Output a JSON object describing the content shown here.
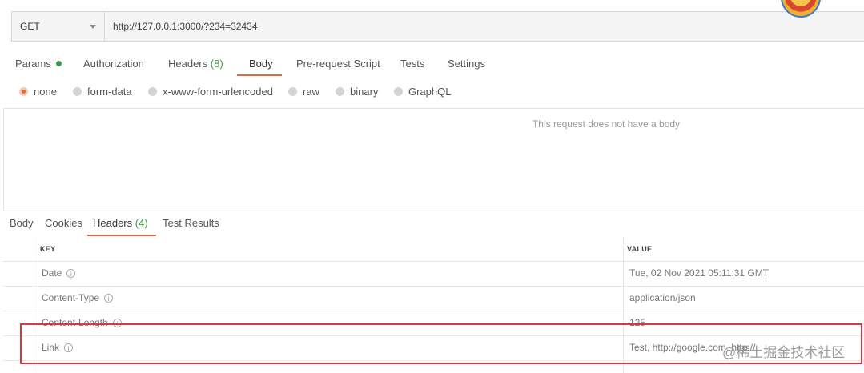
{
  "request": {
    "method": "GET",
    "url": "http://127.0.0.1:3000/?234=32434"
  },
  "req_tabs": [
    {
      "label": "Params"
    },
    {
      "label": "Authorization"
    },
    {
      "label": "Headers",
      "count": "(8)"
    },
    {
      "label": "Body"
    },
    {
      "label": "Pre-request Script"
    },
    {
      "label": "Tests"
    },
    {
      "label": "Settings"
    }
  ],
  "body_types": [
    "none",
    "form-data",
    "x-www-form-urlencoded",
    "raw",
    "binary",
    "GraphQL"
  ],
  "body_empty_text": "This request does not have a body",
  "resp_tabs": [
    {
      "label": "Body"
    },
    {
      "label": "Cookies"
    },
    {
      "label": "Headers",
      "count": "(4)"
    },
    {
      "label": "Test Results"
    }
  ],
  "headers_table": {
    "columns": [
      "KEY",
      "VALUE"
    ],
    "rows": [
      {
        "key": "Date",
        "value": "Tue, 02 Nov 2021 05:11:31 GMT"
      },
      {
        "key": "Content-Type",
        "value": "application/json"
      },
      {
        "key": "Content-Length",
        "value": "125"
      },
      {
        "key": "Link",
        "value": "Test, http://google.com, http://"
      }
    ]
  },
  "watermark": "@稀土掘金技术社区",
  "colors": {
    "accent": "#e3683e",
    "green": "#3d9b46",
    "highlight": "#d9393e"
  }
}
